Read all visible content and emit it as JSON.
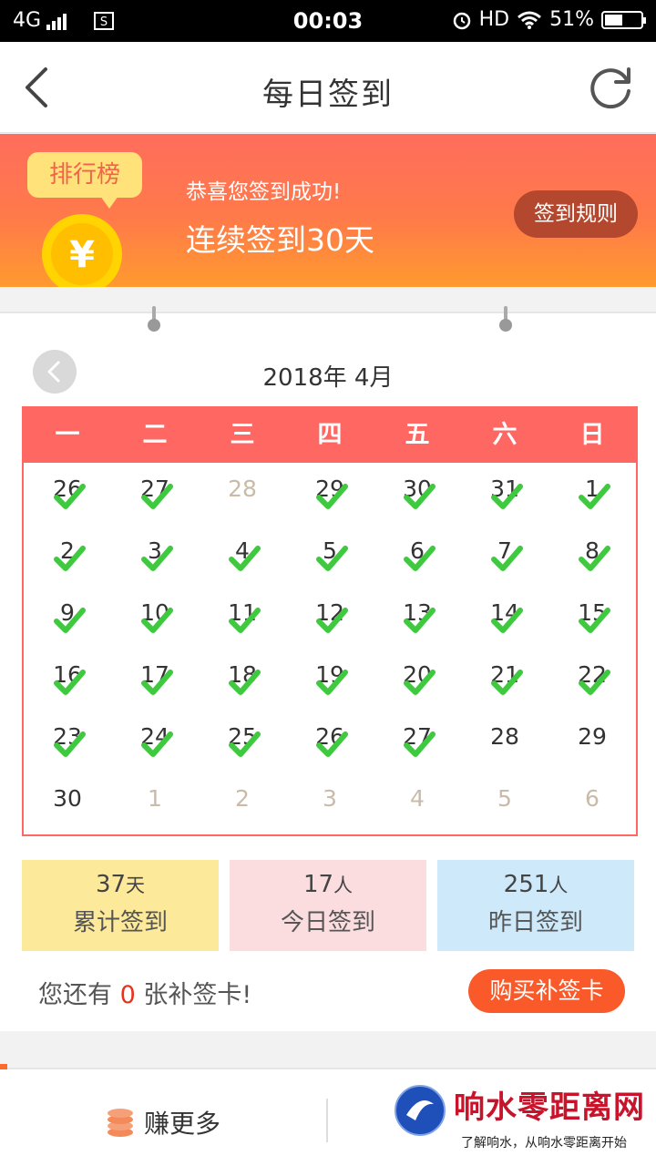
{
  "status_bar": {
    "network": "4G",
    "time": "00:03",
    "hd": "HD",
    "battery": "51%",
    "battery_level": 0.51
  },
  "header": {
    "title": "每日签到",
    "back_icon": "chevron-left-icon",
    "refresh_icon": "refresh-icon"
  },
  "banner": {
    "rank_label": "排行榜",
    "message": "恭喜您签到成功!",
    "streak": "连续签到30天",
    "rules_button": "签到规则",
    "coin_symbol": "¥"
  },
  "calendar": {
    "month_label": "2018年 4月",
    "weekdays": [
      "一",
      "二",
      "三",
      "四",
      "五",
      "六",
      "日"
    ],
    "days": [
      {
        "n": "26",
        "other": false,
        "checked": true
      },
      {
        "n": "27",
        "other": false,
        "checked": true
      },
      {
        "n": "28",
        "other": true,
        "checked": false
      },
      {
        "n": "29",
        "other": false,
        "checked": true
      },
      {
        "n": "30",
        "other": false,
        "checked": true
      },
      {
        "n": "31",
        "other": false,
        "checked": true
      },
      {
        "n": "1",
        "other": false,
        "checked": true
      },
      {
        "n": "2",
        "other": false,
        "checked": true
      },
      {
        "n": "3",
        "other": false,
        "checked": true
      },
      {
        "n": "4",
        "other": false,
        "checked": true
      },
      {
        "n": "5",
        "other": false,
        "checked": true
      },
      {
        "n": "6",
        "other": false,
        "checked": true
      },
      {
        "n": "7",
        "other": false,
        "checked": true
      },
      {
        "n": "8",
        "other": false,
        "checked": true
      },
      {
        "n": "9",
        "other": false,
        "checked": true
      },
      {
        "n": "10",
        "other": false,
        "checked": true
      },
      {
        "n": "11",
        "other": false,
        "checked": true
      },
      {
        "n": "12",
        "other": false,
        "checked": true
      },
      {
        "n": "13",
        "other": false,
        "checked": true
      },
      {
        "n": "14",
        "other": false,
        "checked": true
      },
      {
        "n": "15",
        "other": false,
        "checked": true
      },
      {
        "n": "16",
        "other": false,
        "checked": true
      },
      {
        "n": "17",
        "other": false,
        "checked": true
      },
      {
        "n": "18",
        "other": false,
        "checked": true
      },
      {
        "n": "19",
        "other": false,
        "checked": true
      },
      {
        "n": "20",
        "other": false,
        "checked": true
      },
      {
        "n": "21",
        "other": false,
        "checked": true
      },
      {
        "n": "22",
        "other": false,
        "checked": true
      },
      {
        "n": "23",
        "other": false,
        "checked": true
      },
      {
        "n": "24",
        "other": false,
        "checked": true
      },
      {
        "n": "25",
        "other": false,
        "checked": true
      },
      {
        "n": "26",
        "other": false,
        "checked": true
      },
      {
        "n": "27",
        "other": false,
        "checked": true
      },
      {
        "n": "28",
        "other": false,
        "checked": false
      },
      {
        "n": "29",
        "other": false,
        "checked": false
      },
      {
        "n": "30",
        "other": false,
        "checked": false
      },
      {
        "n": "1",
        "other": true,
        "checked": false
      },
      {
        "n": "2",
        "other": true,
        "checked": false
      },
      {
        "n": "3",
        "other": true,
        "checked": false
      },
      {
        "n": "4",
        "other": true,
        "checked": false
      },
      {
        "n": "5",
        "other": true,
        "checked": false
      },
      {
        "n": "6",
        "other": true,
        "checked": false
      }
    ]
  },
  "stats": {
    "total": {
      "value": "37",
      "unit": "天",
      "label": "累计签到"
    },
    "today": {
      "value": "17",
      "unit": "人",
      "label": "今日签到"
    },
    "yesterday": {
      "value": "251",
      "unit": "人",
      "label": "昨日签到"
    }
  },
  "makeup": {
    "prefix": "您还有",
    "count": "0",
    "suffix": "张补签卡!",
    "buy_button": "购买补签卡"
  },
  "bottom": {
    "earn_label": "赚更多",
    "earn_icon": "coins-icon",
    "watermark_title": "响水零距离网",
    "watermark_sub": "了解响水，从响水零距离开始"
  },
  "colors": {
    "accent": "#ff6763",
    "check": "#3ec93e",
    "buy": "#fa5a2a"
  }
}
